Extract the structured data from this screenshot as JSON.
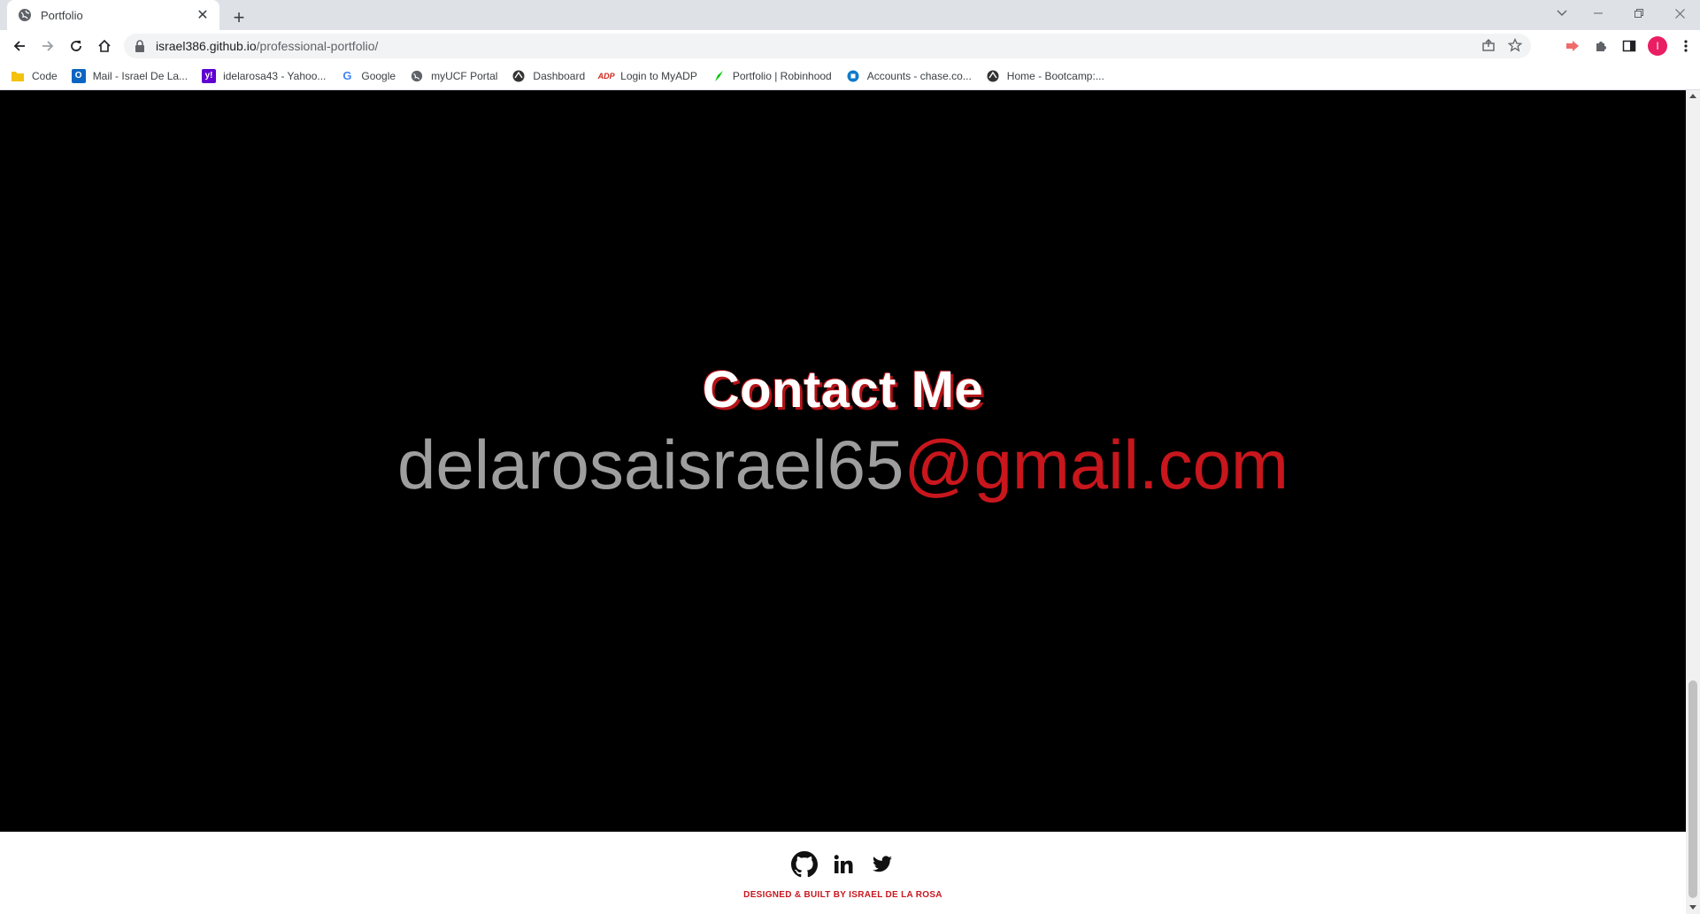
{
  "browser": {
    "tab": {
      "title": "Portfolio",
      "favicon": "globe-icon"
    },
    "window_controls": [
      "chevron-down-icon",
      "minimize-icon",
      "restore-icon",
      "close-icon"
    ],
    "url": {
      "host": "israel386.github.io",
      "path": "/professional-portfolio/"
    },
    "bookmarks": [
      {
        "label": "Code",
        "icon": "folder-icon",
        "color": "#f4c20d"
      },
      {
        "label": "Mail - Israel De La...",
        "icon": "outlook-icon",
        "color": "#0a64c2"
      },
      {
        "label": "idelarosa43 - Yahoo...",
        "icon": "yahoo-icon",
        "color": "#6001d2"
      },
      {
        "label": "Google",
        "icon": "google-icon",
        "color": "#4285f4"
      },
      {
        "label": "myUCF Portal",
        "icon": "globe-icon",
        "color": "#5f6368"
      },
      {
        "label": "Dashboard",
        "icon": "bootcamp-icon",
        "color": "#333333"
      },
      {
        "label": "Login to MyADP",
        "icon": "adp-icon",
        "color": "#d0271d"
      },
      {
        "label": "Portfolio | Robinhood",
        "icon": "robinhood-icon",
        "color": "#00c805"
      },
      {
        "label": "Accounts - chase.co...",
        "icon": "chase-icon",
        "color": "#117aca"
      },
      {
        "label": "Home - Bootcamp:...",
        "icon": "bootcamp-icon",
        "color": "#333333"
      }
    ],
    "profile_initial": "I"
  },
  "page": {
    "contact_title": "Contact Me",
    "email_user": "delarosaisrael65",
    "email_domain": "@gmail.com",
    "social": [
      "github-icon",
      "linkedin-icon",
      "twitter-icon"
    ],
    "credit": "DESIGNED & BUILT BY ISRAEL DE LA ROSA"
  },
  "colors": {
    "accent_red": "#c8161d",
    "email_gray": "#9e9e9e",
    "section_bg": "#000000"
  },
  "scrollbar": {
    "position_fraction": 0.87
  }
}
